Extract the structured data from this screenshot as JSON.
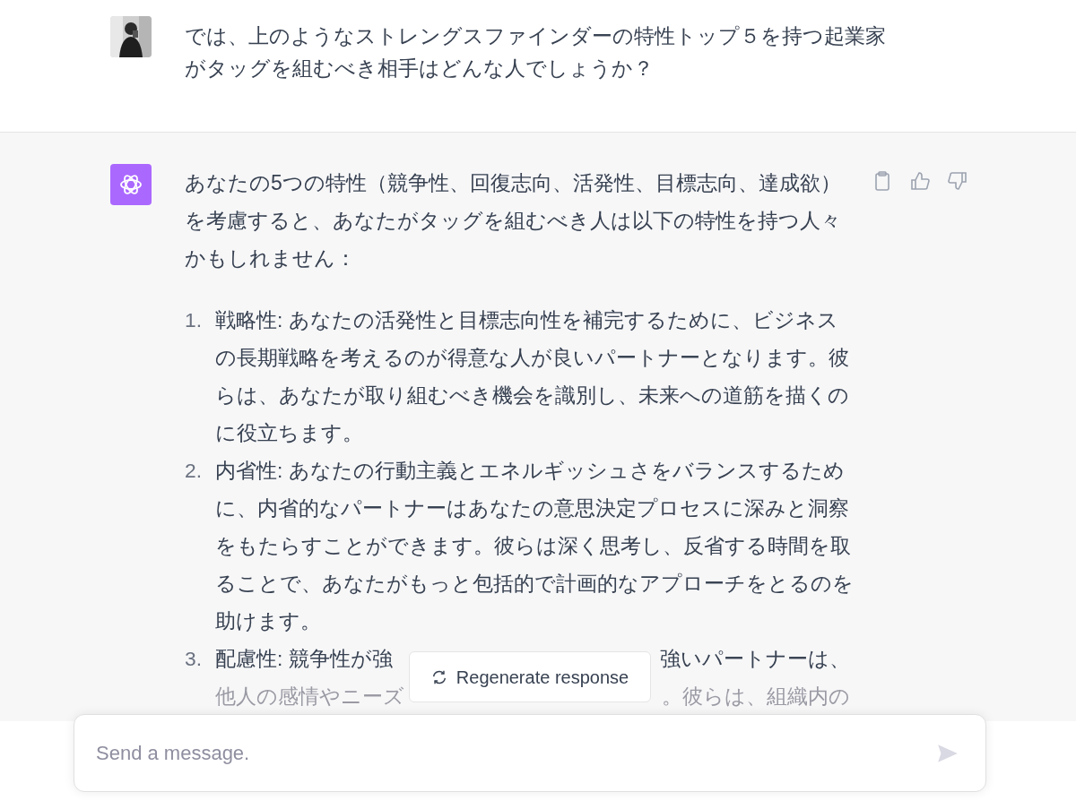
{
  "user_message": {
    "text": "では、上のようなストレングスファインダーの特性トップ５を持つ起業家がタッグを組むべき相手はどんな人でしょうか？"
  },
  "assistant_message": {
    "intro": "あなたの5つの特性（競争性、回復志向、活発性、目標志向、達成欲）を考慮すると、あなたがタッグを組むべき人は以下の特性を持つ人々かもしれません：",
    "items": [
      {
        "kind": "full",
        "number": "1.",
        "text": "戦略性: あなたの活発性と目標志向性を補完するために、ビジネスの長期戦略を考えるのが得意な人が良いパートナーとなります。彼らは、あなたが取り組むべき機会を識別し、未来への道筋を描くのに役立ちます。"
      },
      {
        "kind": "full",
        "number": "2.",
        "text": "内省性: あなたの行動主義とエネルギッシュさをバランスするために、内省的なパートナーはあなたの意思決定プロセスに深みと洞察をもたらすことができます。彼らは深く思考し、反省する時間を取ることで、あなたがもっと包括的で計画的なアプローチをとるのを助けます。"
      },
      {
        "kind": "partial",
        "number": "3.",
        "segments": [
          "配慮性: 競争性が強",
          "強いパートナーは、"
        ],
        "next_line": [
          "他人の感情やニーズ",
          "。彼らは、組織内の"
        ]
      }
    ]
  },
  "regenerate_button": {
    "label": "Regenerate response"
  },
  "composer": {
    "placeholder": "Send a message."
  }
}
